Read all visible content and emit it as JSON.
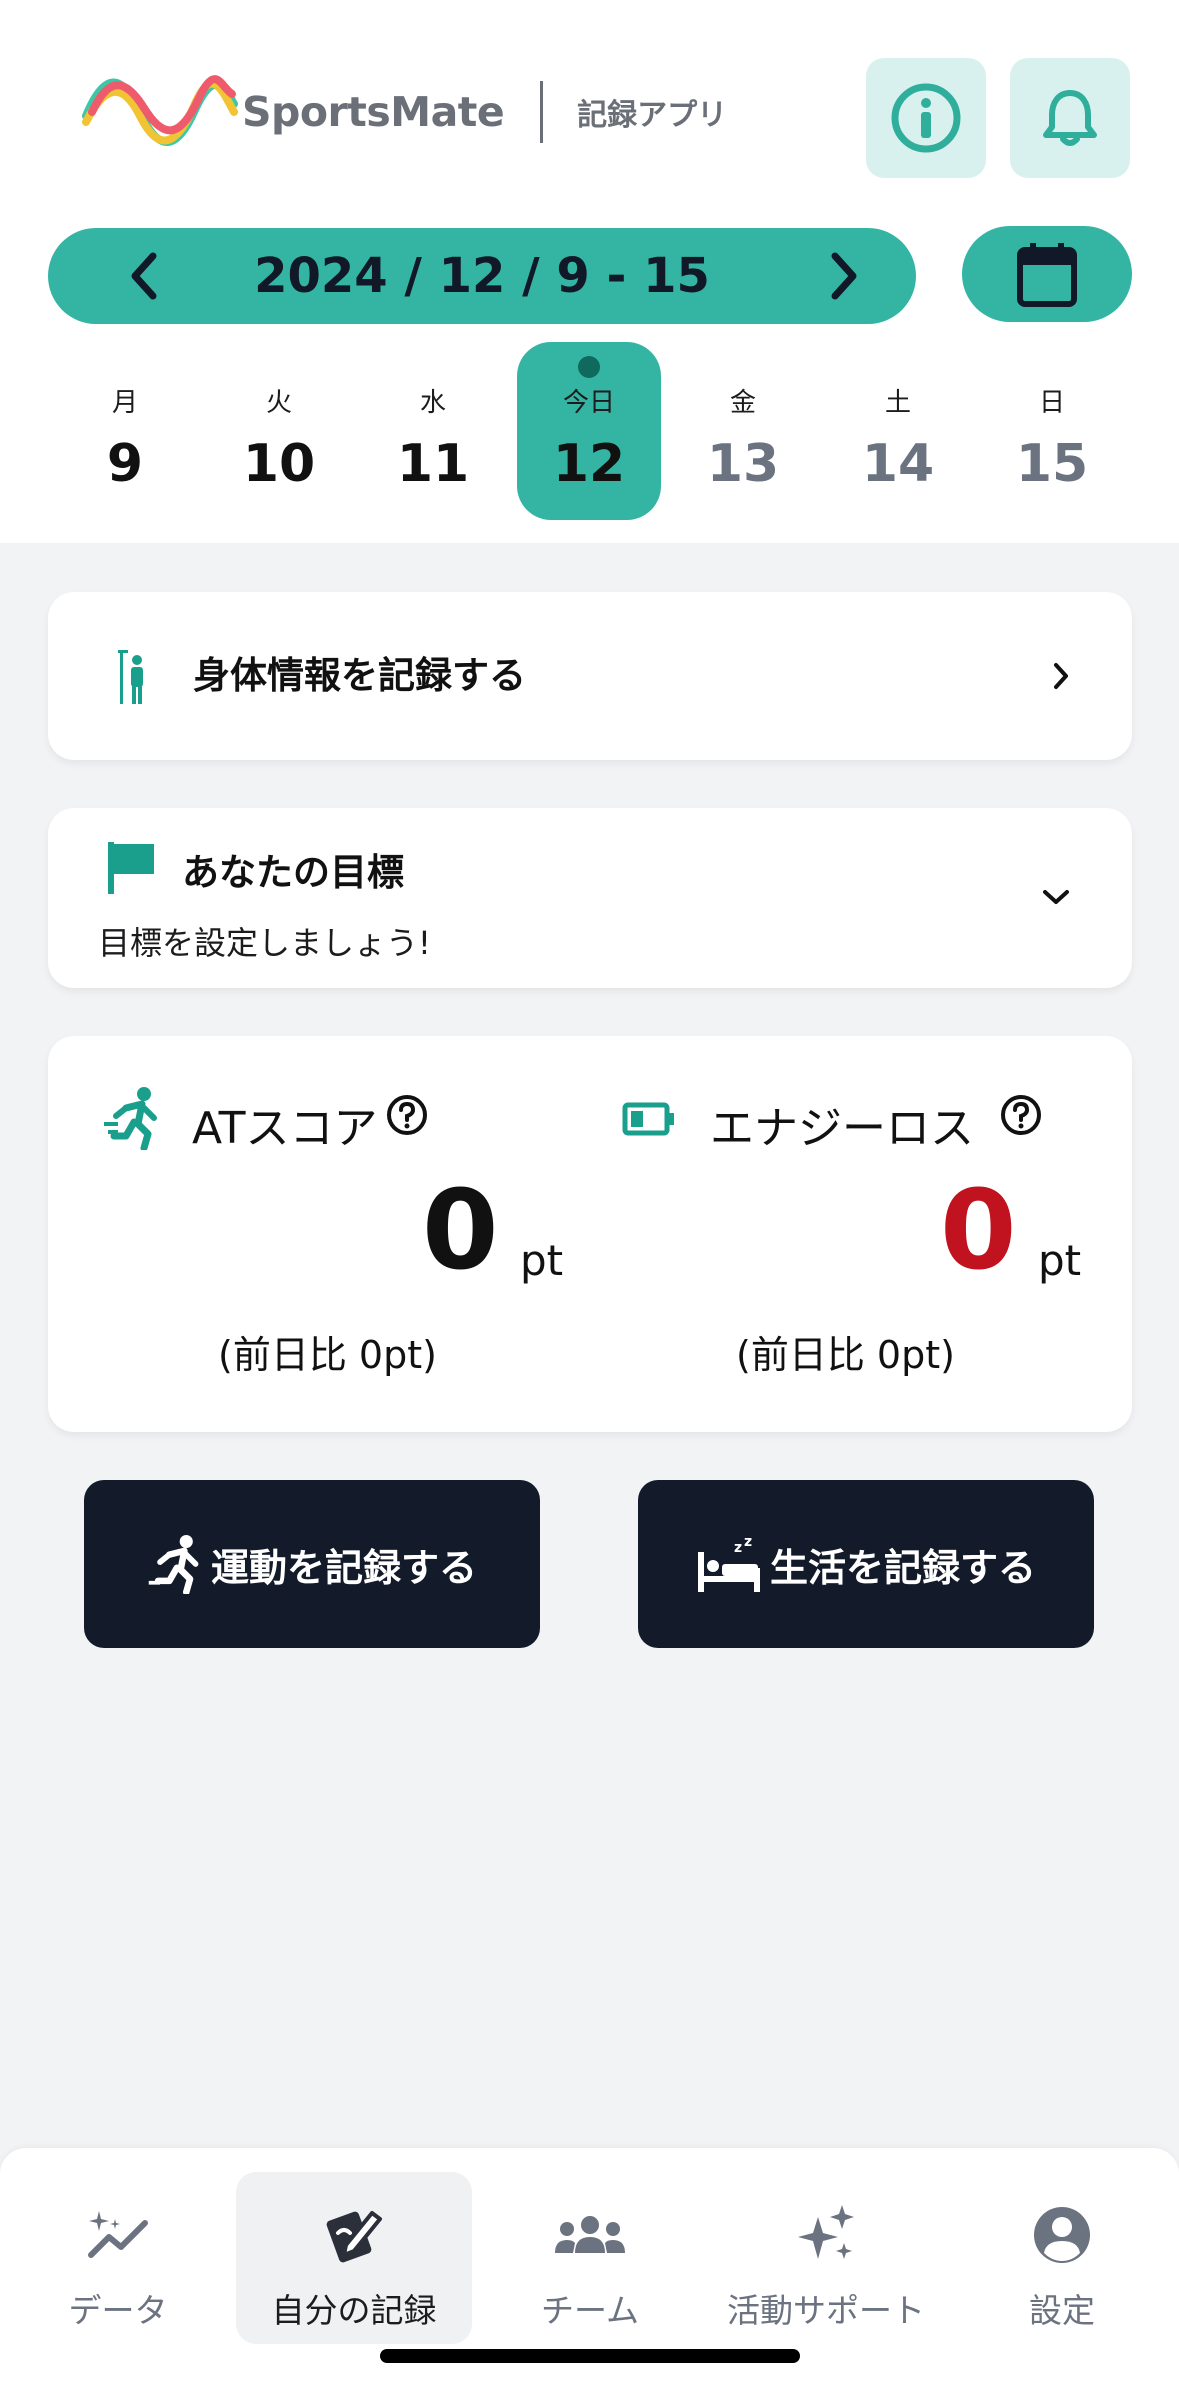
{
  "header": {
    "brand": "SportsMate",
    "subtitle": "記録アプリ",
    "info_icon": "info-icon",
    "bell_icon": "bell-icon"
  },
  "week": {
    "range": "2024 / 12 / 9 - 15",
    "prev_icon": "chevron-left-icon",
    "next_icon": "chevron-right-icon",
    "calendar_icon": "calendar-icon"
  },
  "days": [
    {
      "name": "月",
      "num": "9"
    },
    {
      "name": "火",
      "num": "10"
    },
    {
      "name": "水",
      "num": "11"
    },
    {
      "name": "今日",
      "num": "12"
    },
    {
      "name": "金",
      "num": "13"
    },
    {
      "name": "土",
      "num": "14"
    },
    {
      "name": "日",
      "num": "15"
    }
  ],
  "body_info": {
    "label": "身体情報を記録する"
  },
  "goal": {
    "title": "あなたの目標",
    "subtitle": "目標を設定しましょう!"
  },
  "scores": {
    "at": {
      "label": "ATスコア",
      "value": "0",
      "unit": "pt",
      "diff": "(前日比 0pt)"
    },
    "energy": {
      "label": "エナジーロス",
      "value": "0",
      "unit": "pt",
      "diff": "(前日比 0pt)"
    }
  },
  "actions": {
    "exercise": "運動を記録する",
    "life": "生活を記録する"
  },
  "nav": [
    {
      "label": "データ",
      "icon": "data-sparkle-chart-icon"
    },
    {
      "label": "自分の記録",
      "icon": "edit-record-icon"
    },
    {
      "label": "チーム",
      "icon": "team-icon"
    },
    {
      "label": "活動サポート",
      "icon": "sparkles-icon"
    },
    {
      "label": "設定",
      "icon": "account-settings-icon"
    }
  ],
  "colors": {
    "accent": "#34b5a4",
    "accent_light": "#d8f1ee",
    "dark_button": "#131a2a",
    "energy_value": "#c1121f"
  }
}
